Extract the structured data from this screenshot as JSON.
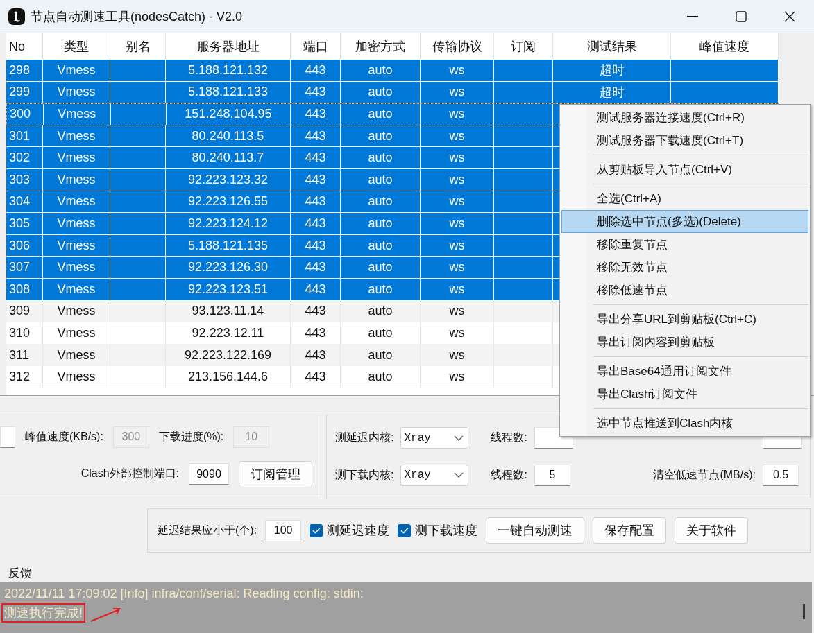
{
  "window": {
    "title": "节点自动测速工具(nodesCatch) - V2.0"
  },
  "table": {
    "columns": [
      "No",
      "类型",
      "别名",
      "服务器地址",
      "端口",
      "加密方式",
      "传输协议",
      "订阅",
      "测试结果",
      "峰值速度"
    ],
    "rows": [
      {
        "cells": [
          "298",
          "Vmess",
          null,
          "5.188.121.132",
          "443",
          "auto",
          "ws",
          null,
          "超时",
          null
        ],
        "selected": true,
        "focused": false
      },
      {
        "cells": [
          "299",
          "Vmess",
          null,
          "5.188.121.133",
          "443",
          "auto",
          "ws",
          null,
          "超时",
          null
        ],
        "selected": true,
        "focused": false
      },
      {
        "cells": [
          "300",
          "Vmess",
          null,
          "151.248.104.95",
          "443",
          "auto",
          "ws",
          null,
          null,
          null
        ],
        "selected": true,
        "focused": true
      },
      {
        "cells": [
          "301",
          "Vmess",
          null,
          "80.240.113.5",
          "443",
          "auto",
          "ws",
          null,
          null,
          null
        ],
        "selected": true,
        "focused": false
      },
      {
        "cells": [
          "302",
          "Vmess",
          null,
          "80.240.113.7",
          "443",
          "auto",
          "ws",
          null,
          null,
          null
        ],
        "selected": true,
        "focused": false
      },
      {
        "cells": [
          "303",
          "Vmess",
          null,
          "92.223.123.32",
          "443",
          "auto",
          "ws",
          null,
          null,
          null
        ],
        "selected": true,
        "focused": false
      },
      {
        "cells": [
          "304",
          "Vmess",
          null,
          "92.223.126.55",
          "443",
          "auto",
          "ws",
          null,
          null,
          null
        ],
        "selected": true,
        "focused": false
      },
      {
        "cells": [
          "305",
          "Vmess",
          null,
          "92.223.124.12",
          "443",
          "auto",
          "ws",
          null,
          null,
          null
        ],
        "selected": true,
        "focused": false
      },
      {
        "cells": [
          "306",
          "Vmess",
          null,
          "5.188.121.135",
          "443",
          "auto",
          "ws",
          null,
          null,
          null
        ],
        "selected": true,
        "focused": false
      },
      {
        "cells": [
          "307",
          "Vmess",
          null,
          "92.223.126.30",
          "443",
          "auto",
          "ws",
          null,
          null,
          null
        ],
        "selected": true,
        "focused": false
      },
      {
        "cells": [
          "308",
          "Vmess",
          null,
          "92.223.123.51",
          "443",
          "auto",
          "ws",
          null,
          null,
          null
        ],
        "selected": true,
        "focused": false
      },
      {
        "cells": [
          "309",
          "Vmess",
          null,
          "93.123.11.14",
          "443",
          "auto",
          "ws",
          null,
          null,
          null
        ],
        "selected": false,
        "focused": false
      },
      {
        "cells": [
          "310",
          "Vmess",
          null,
          "92.223.12.11",
          "443",
          "auto",
          "ws",
          null,
          null,
          null
        ],
        "selected": false,
        "focused": false
      },
      {
        "cells": [
          "311",
          "Vmess",
          null,
          "92.223.122.169",
          "443",
          "auto",
          "ws",
          null,
          null,
          null
        ],
        "selected": false,
        "focused": false
      },
      {
        "cells": [
          "312",
          "Vmess",
          null,
          "213.156.144.6",
          "443",
          "auto",
          "ws",
          null,
          null,
          null
        ],
        "selected": false,
        "focused": false
      }
    ]
  },
  "context_menu": {
    "sections": [
      [
        {
          "label": "测试服务器连接速度(Ctrl+R)",
          "selected": false
        },
        {
          "label": "测试服务器下载速度(Ctrl+T)",
          "selected": false
        }
      ],
      [
        {
          "label": "从剪贴板导入节点(Ctrl+V)",
          "selected": false
        }
      ],
      [
        {
          "label": "全选(Ctrl+A)",
          "selected": false
        },
        {
          "label": "删除选中节点(多选)(Delete)",
          "selected": true
        },
        {
          "label": "移除重复节点",
          "selected": false
        },
        {
          "label": "移除无效节点",
          "selected": false
        },
        {
          "label": "移除低速节点",
          "selected": false
        }
      ],
      [
        {
          "label": "导出分享URL到剪贴板(Ctrl+C)",
          "selected": false
        },
        {
          "label": "导出订阅内容到剪贴板",
          "selected": false
        }
      ],
      [
        {
          "label": "导出Base64通用订阅文件",
          "selected": false
        },
        {
          "label": "导出Clash订阅文件",
          "selected": false
        }
      ],
      [
        {
          "label": "选中节点推送到Clash内核",
          "selected": false
        }
      ]
    ]
  },
  "settings": {
    "groups": [
      {
        "lines": [
          {
            "controls": [
              {
                "kind": "field",
                "disabled": false
              },
              {
                "kind": "label",
                "text": "峰值速度(KB/s):"
              },
              {
                "kind": "field",
                "value": "300",
                "disabled": true
              },
              {
                "kind": "label",
                "text": "下载进度(%):"
              },
              {
                "kind": "field",
                "value": "10",
                "disabled": true
              }
            ]
          },
          {
            "controls": [
              {
                "kind": "label",
                "text": "Clash外部控制端口:"
              },
              {
                "kind": "field",
                "value": "9090",
                "disabled": false
              },
              {
                "kind": "button",
                "text": "订阅管理"
              }
            ]
          }
        ]
      },
      {
        "lines": [
          {
            "controls": [
              {
                "kind": "label",
                "text": "测延迟内核:"
              },
              {
                "kind": "select",
                "value": "Xray"
              },
              {
                "kind": "label",
                "text": "线程数:"
              },
              {
                "kind": "field",
                "disabled": false
              },
              {
                "kind": "label"
              },
              {
                "kind": "field",
                "disabled": false
              }
            ]
          },
          {
            "controls": [
              {
                "kind": "label",
                "text": "测下载内核:"
              },
              {
                "kind": "select",
                "value": "Xray"
              },
              {
                "kind": "label",
                "text": "线程数:"
              },
              {
                "kind": "field",
                "value": "5",
                "disabled": false
              },
              {
                "kind": "label",
                "text": "清空低速节点(MB/s):"
              },
              {
                "kind": "field",
                "value": "0.5",
                "disabled": false
              }
            ]
          }
        ]
      },
      {
        "lines": [
          {
            "controls": [
              {
                "kind": "label",
                "text": "延迟结果应小于(个):"
              },
              {
                "kind": "field",
                "value": "100",
                "disabled": false
              },
              {
                "kind": "checkbox",
                "text": "测延迟速度",
                "checked": true
              },
              {
                "kind": "checkbox",
                "text": "测下载速度",
                "checked": true
              },
              {
                "kind": "button",
                "text": "一键自动测速"
              },
              {
                "kind": "button",
                "text": "保存配置"
              },
              {
                "kind": "button",
                "text": "关于软件"
              }
            ]
          }
        ]
      }
    ]
  },
  "feedback": {
    "title": "反馈",
    "lines": [
      {
        "text": "2022/11/11 17:09:02 [Info] infra/conf/serial: Reading config: stdin:",
        "highlighted": false
      },
      {
        "text": "测速执行完成!",
        "highlighted": true
      }
    ]
  }
}
